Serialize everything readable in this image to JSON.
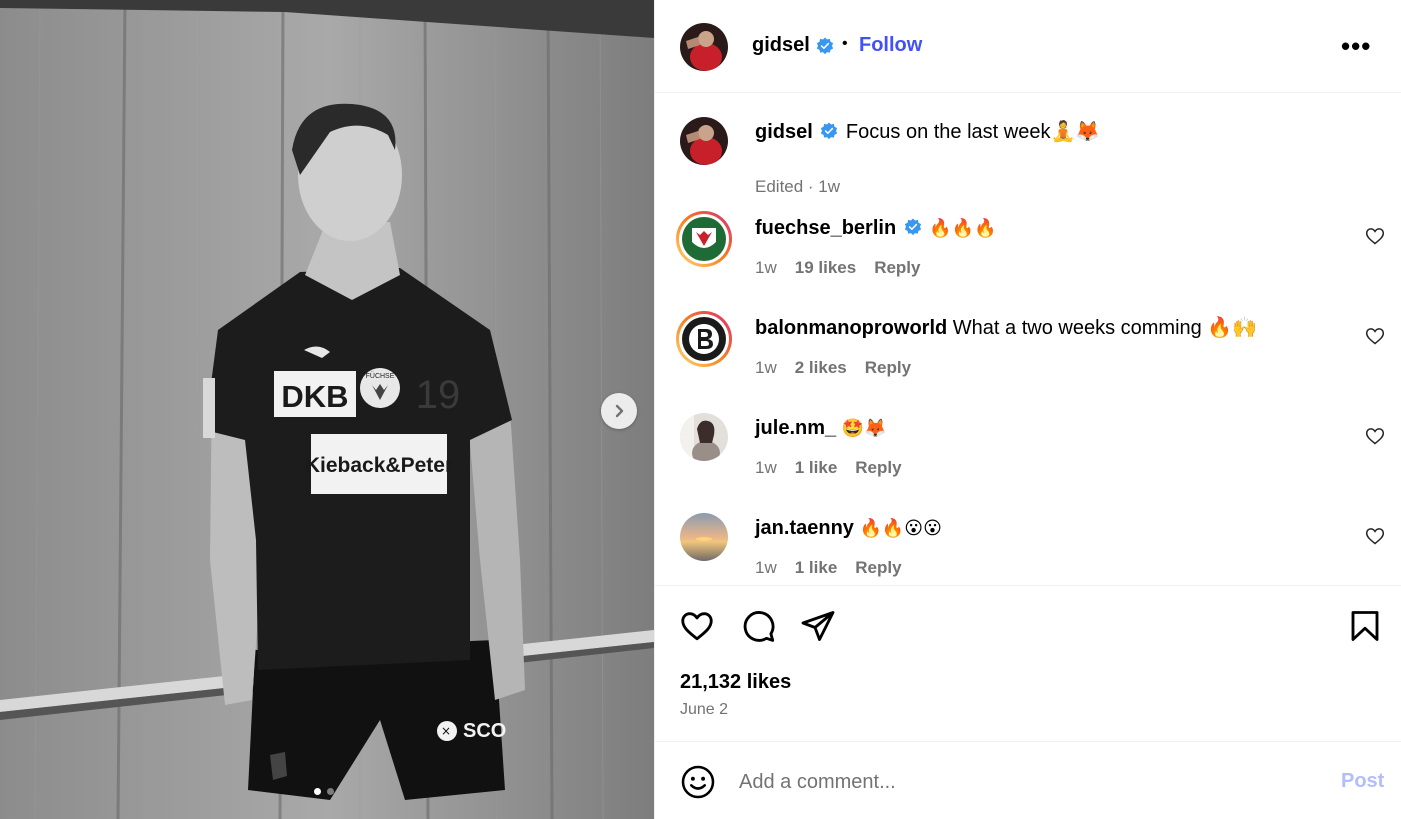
{
  "header": {
    "username": "gidsel",
    "separator": "•",
    "follow_label": "Follow",
    "more_label": "•••"
  },
  "caption": {
    "username": "gidsel",
    "text": "Focus on the last week🧘🦊",
    "meta": "Edited · 1w"
  },
  "comments": [
    {
      "username": "fuechse_berlin",
      "verified": true,
      "text": "🔥🔥🔥",
      "time": "1w",
      "likes": "19 likes",
      "reply": "Reply"
    },
    {
      "username": "balonmanoproworld",
      "verified": false,
      "text": "What a two weeks comming 🔥🙌",
      "time": "1w",
      "likes": "2 likes",
      "reply": "Reply"
    },
    {
      "username": "jule.nm_",
      "verified": false,
      "text": "🤩🦊",
      "time": "1w",
      "likes": "1 like",
      "reply": "Reply"
    },
    {
      "username": "jan.taenny",
      "verified": false,
      "text": "🔥🔥😮😮",
      "time": "1w",
      "likes": "1 like",
      "reply": "Reply"
    }
  ],
  "post": {
    "likes": "21,132 likes",
    "date": "June 2"
  },
  "comment_box": {
    "placeholder": "Add a comment...",
    "post_label": "Post"
  },
  "media": {
    "jersey_sponsor_1": "DKB",
    "jersey_sponsor_2": "Kieback&Peter",
    "jersey_number": "19",
    "badge_text": "FÜCHSE",
    "shorts_text": "SCO"
  },
  "colors": {
    "accent": "#4150f7",
    "muted": "#737373",
    "post_disabled": "#b3bdfc",
    "verified": "#3897f0"
  }
}
